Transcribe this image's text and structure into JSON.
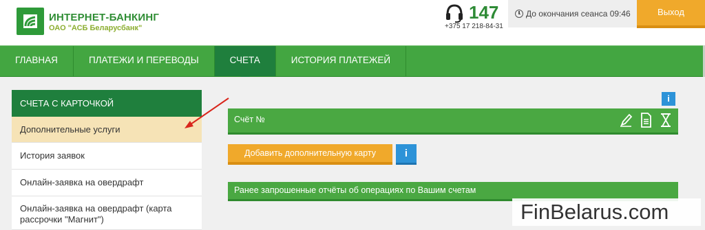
{
  "header": {
    "brand_title": "ИНТЕРНЕТ-БАНКИНГ",
    "brand_subtitle": "ОАО \"АСБ Беларусбанк\"",
    "phone_short": "147",
    "phone_full": "+375 17 218-84-31",
    "session_label": "До окончания сеанса 09:46",
    "logout_label": "Выход"
  },
  "nav": {
    "items": [
      {
        "label": "ГЛАВНАЯ"
      },
      {
        "label": "ПЛАТЕЖИ И ПЕРЕВОДЫ"
      },
      {
        "label": "СЧЕТА"
      },
      {
        "label": "ИСТОРИЯ ПЛАТЕЖЕЙ"
      }
    ],
    "active": "СЧЕТА"
  },
  "sidebar": {
    "title": "СЧЕТА С КАРТОЧКОЙ",
    "items": [
      {
        "label": "Дополнительные услуги"
      },
      {
        "label": "История заявок"
      },
      {
        "label": "Онлайн-заявка на овердрафт"
      },
      {
        "label": "Онлайн-заявка на овердрафт (карта рассрочки \"Магнит\")"
      }
    ],
    "active": "Дополнительные услуги"
  },
  "main": {
    "info_icon_label": "i",
    "account_label": "Счёт №",
    "add_card_label": "Добавить дополнительную карту",
    "info_button_label": "i",
    "reports_label": "Ранее запрошенные отчёты об операциях по Вашим счетам",
    "account_icons": [
      "pencil-icon",
      "document-icon",
      "hourglass-icon"
    ]
  },
  "watermark": {
    "text": "FinBelarus.com"
  },
  "colors": {
    "brand_green": "#43a641",
    "dark_green": "#1f7f3d",
    "accent_orange": "#f0a92b",
    "info_blue": "#2d93d8",
    "active_item_bg": "#f6e3b6"
  }
}
